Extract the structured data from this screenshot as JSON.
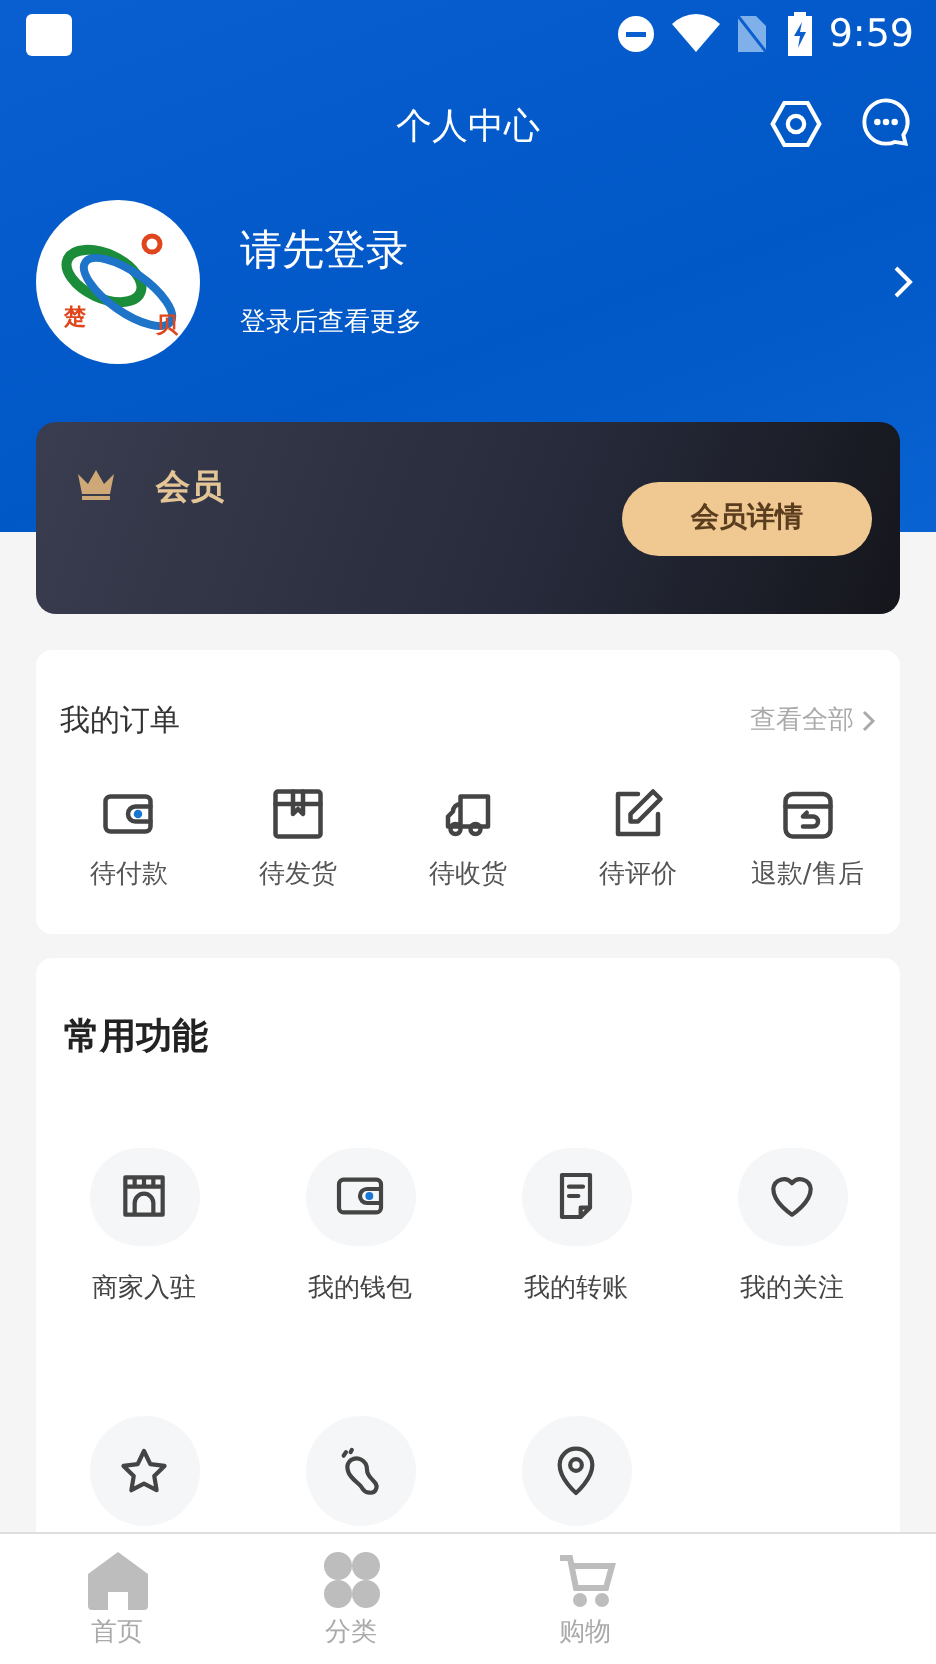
{
  "status_bar": {
    "time": "9:59"
  },
  "header": {
    "title": "个人中心"
  },
  "profile": {
    "name": "请先登录",
    "subtitle": "登录后查看更多",
    "logo_left": "楚",
    "logo_right": "贝"
  },
  "member_card": {
    "label": "会员",
    "button": "会员详情"
  },
  "orders": {
    "title": "我的订单",
    "view_all": "查看全部",
    "items": [
      {
        "kind": "wallet",
        "label": "待付款"
      },
      {
        "kind": "box",
        "label": "待发货"
      },
      {
        "kind": "truck",
        "label": "待收货"
      },
      {
        "kind": "edit",
        "label": "待评价"
      },
      {
        "kind": "refund",
        "label": "退款/售后"
      }
    ]
  },
  "functions": {
    "title": "常用功能",
    "items": [
      {
        "kind": "store",
        "label": "商家入驻"
      },
      {
        "kind": "wallet",
        "label": "我的钱包"
      },
      {
        "kind": "document",
        "label": "我的转账"
      },
      {
        "kind": "heart",
        "label": "我的关注"
      },
      {
        "kind": "star"
      },
      {
        "kind": "footprint"
      },
      {
        "kind": "pin"
      }
    ]
  },
  "tab_bar": [
    {
      "kind": "home",
      "label": "首页",
      "selected": false
    },
    {
      "kind": "grid",
      "label": "分类",
      "selected": false
    },
    {
      "kind": "cart",
      "label": "购物",
      "selected": false
    }
  ]
}
